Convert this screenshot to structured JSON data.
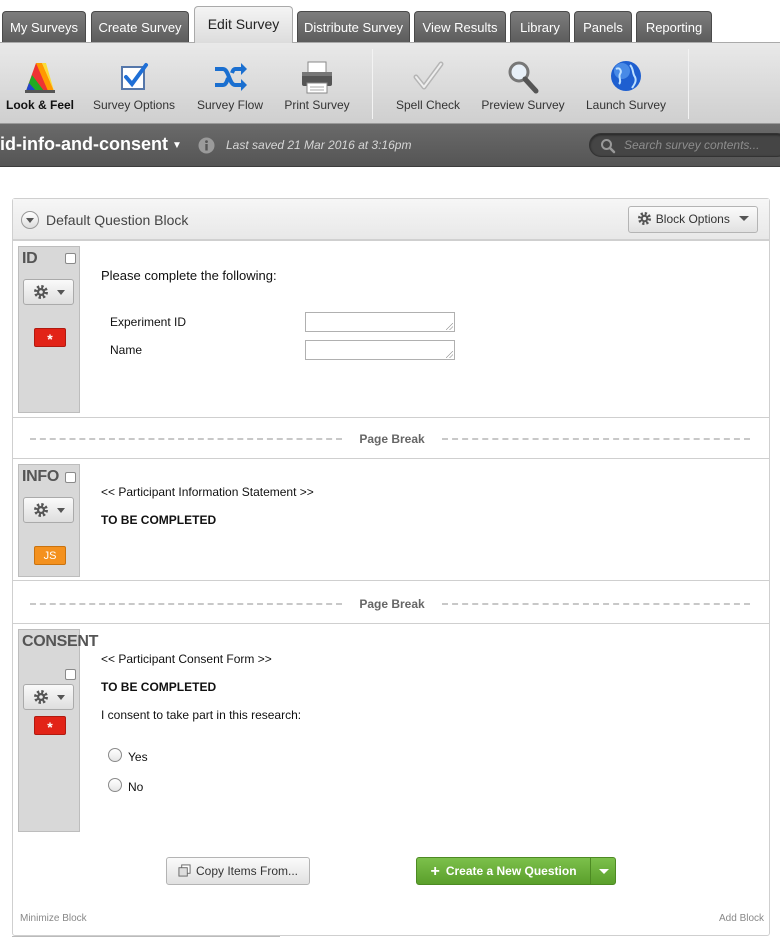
{
  "tabs": [
    {
      "label": "My Surveys"
    },
    {
      "label": "Create Survey"
    },
    {
      "label": "Edit Survey",
      "active": true
    },
    {
      "label": "Distribute Survey"
    },
    {
      "label": "View Results"
    },
    {
      "label": "Library"
    },
    {
      "label": "Panels"
    },
    {
      "label": "Reporting"
    }
  ],
  "toolbar": {
    "items": [
      {
        "label": "Look & Feel",
        "icon": "look-and-feel-icon",
        "selected": true
      },
      {
        "label": "Survey Options",
        "icon": "checkbox-icon"
      },
      {
        "label": "Survey Flow",
        "icon": "shuffle-arrows-icon"
      },
      {
        "label": "Print Survey",
        "icon": "printer-icon"
      },
      {
        "label": "Spell Check",
        "icon": "checkmark-icon"
      },
      {
        "label": "Preview Survey",
        "icon": "magnifier-icon"
      },
      {
        "label": "Launch Survey",
        "icon": "globe-icon"
      }
    ]
  },
  "survey": {
    "name": "id-info-and-consent",
    "last_saved": "Last saved 21 Mar 2016 at 3:16pm",
    "search_placeholder": "Search survey contents..."
  },
  "block": {
    "title": "Default Question Block",
    "options_label": "Block Options",
    "copy_label": "Copy Items From...",
    "create_label": "Create a New Question",
    "minimize_label": "Minimize Block",
    "add_label": "Add Block"
  },
  "page_break_label": "Page Break",
  "questions": {
    "q1": {
      "id": "ID",
      "badge": "*",
      "text": "Please complete the following:",
      "fields": [
        {
          "label": "Experiment ID",
          "value": ""
        },
        {
          "label": "Name",
          "value": ""
        }
      ]
    },
    "q2": {
      "id": "INFO",
      "badge": "JS",
      "line1": "<< Participant Information Statement >>",
      "line2": "TO BE COMPLETED"
    },
    "q3": {
      "id": "CONSENT",
      "badge": "*",
      "line1": "<< Participant Consent Form >>",
      "line2": "TO BE COMPLETED",
      "line3": "I consent to take part in this research:",
      "options": [
        "Yes",
        "No"
      ]
    }
  },
  "colors": {
    "accent_green": "#5a9f2b",
    "required_red": "#e22317",
    "js_orange": "#f4911e",
    "title_bar": "#5e5e5e"
  }
}
